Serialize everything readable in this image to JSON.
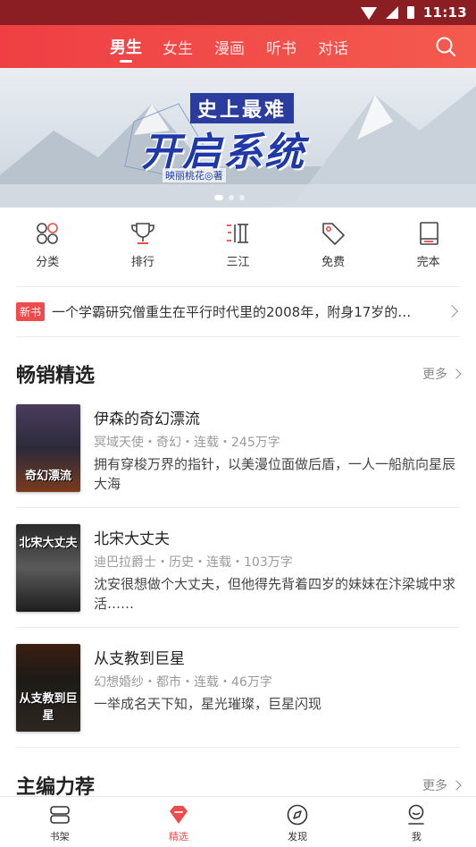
{
  "status_bar": {
    "time": "11:13"
  },
  "top_nav": {
    "tabs": [
      {
        "label": "男生",
        "active": true
      },
      {
        "label": "女生",
        "active": false
      },
      {
        "label": "漫画",
        "active": false
      },
      {
        "label": "听书",
        "active": false
      },
      {
        "label": "对话",
        "active": false
      }
    ],
    "search_icon": "search-icon"
  },
  "banner": {
    "title_top": "史上最难",
    "title_main": "开启系统",
    "author": "映丽桃花◎著"
  },
  "categories": [
    {
      "label": "分类",
      "icon": "grid-circles-icon"
    },
    {
      "label": "排行",
      "icon": "trophy-icon"
    },
    {
      "label": "三江",
      "icon": "sanjiang-icon"
    },
    {
      "label": "免费",
      "icon": "tag-icon"
    },
    {
      "label": "完本",
      "icon": "book-icon"
    }
  ],
  "ticker": {
    "badge": "新书",
    "text": "一个学霸研究僧重生在平行时代里的2008年，附身17岁的…"
  },
  "section_bestseller": {
    "title": "畅销精选",
    "more": "更多"
  },
  "books": [
    {
      "name": "伊森的奇幻漂流",
      "meta": "冥域天使・奇幻・连载・245万字",
      "desc": "拥有穿梭万界的指针，以美漫位面做后盾，一人一船航向星辰大海",
      "cover_text": "奇幻漂流",
      "cover_color": "#2b2a3a"
    },
    {
      "name": "北宋大丈夫",
      "meta": "迪巴拉爵士・历史・连载・103万字",
      "desc": "沈安很想做个大丈夫，但他得先背着四岁的妹妹在汴梁城中求活……",
      "cover_text": "北宋大丈夫",
      "cover_color": "#3a3a3a"
    },
    {
      "name": "从支教到巨星",
      "meta": "幻想婚纱・都市・连载・46万字",
      "desc": "一举成名天下知，星光璀璨，巨星闪现",
      "cover_text": "从支教到巨星",
      "cover_color": "#1e1a16"
    }
  ],
  "section_editor": {
    "title": "主编力荐",
    "more": "更多"
  },
  "bottom_nav": [
    {
      "label": "书架",
      "icon": "bookshelf-icon",
      "active": false
    },
    {
      "label": "精选",
      "icon": "diamond-icon",
      "active": true
    },
    {
      "label": "发现",
      "icon": "compass-icon",
      "active": false
    },
    {
      "label": "我",
      "icon": "profile-icon",
      "active": false
    }
  ],
  "colors": {
    "accent": "#ef4b4f",
    "status_bar": "#8b1e22",
    "nav_gradient_start": "#ef3f44",
    "nav_gradient_end": "#f45a4e"
  }
}
